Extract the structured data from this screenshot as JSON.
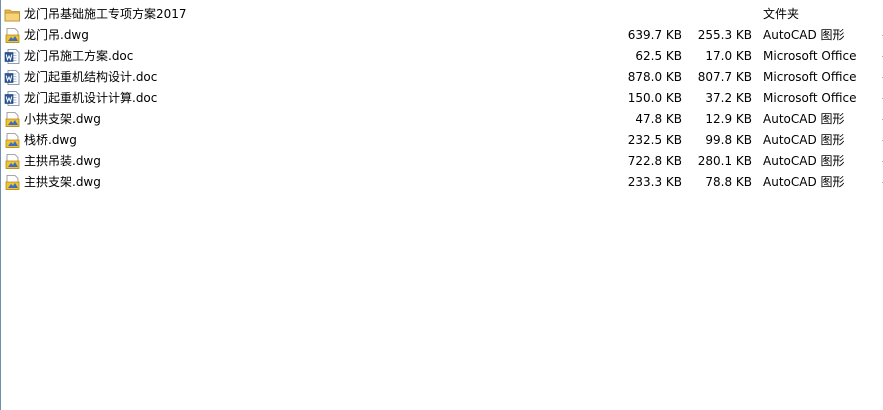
{
  "files": [
    {
      "name": "龙门吊基础施工专项方案2017",
      "size": "",
      "packed": "",
      "type": "文件夹",
      "icon": "folder-icon"
    },
    {
      "name": "龙门吊.dwg",
      "size": "639.7 KB",
      "packed": "255.3 KB",
      "type": "AutoCAD 图形",
      "icon": "dwg-file-icon"
    },
    {
      "name": "龙门吊施工方案.doc",
      "size": "62.5 KB",
      "packed": "17.0 KB",
      "type": "Microsoft Office",
      "icon": "word-doc-icon"
    },
    {
      "name": "龙门起重机结构设计.doc",
      "size": "878.0 KB",
      "packed": "807.7 KB",
      "type": "Microsoft Office",
      "icon": "word-doc-icon"
    },
    {
      "name": "龙门起重机设计计算.doc",
      "size": "150.0 KB",
      "packed": "37.2 KB",
      "type": "Microsoft Office",
      "icon": "word-doc-icon"
    },
    {
      "name": "小拱支架.dwg",
      "size": "47.8 KB",
      "packed": "12.9 KB",
      "type": "AutoCAD 图形",
      "icon": "dwg-file-icon"
    },
    {
      "name": "栈桥.dwg",
      "size": "232.5 KB",
      "packed": "99.8 KB",
      "type": "AutoCAD 图形",
      "icon": "dwg-file-icon"
    },
    {
      "name": "主拱吊装.dwg",
      "size": "722.8 KB",
      "packed": "280.1 KB",
      "type": "AutoCAD 图形",
      "icon": "dwg-file-icon"
    },
    {
      "name": "主拱支架.dwg",
      "size": "233.3 KB",
      "packed": "78.8 KB",
      "type": "AutoCAD 图形",
      "icon": "dwg-file-icon"
    }
  ]
}
